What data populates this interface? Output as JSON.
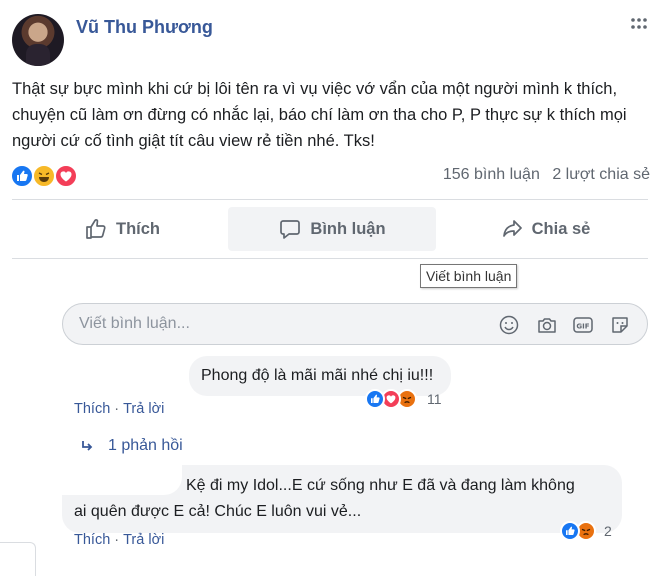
{
  "post": {
    "author": "Vũ Thu Phương",
    "text": "Thật sự bực mình khi cứ bị lôi tên ra vì vụ việc vớ vẩn của một người mình k thích, chuyện cũ làm ơn đừng có nhắc lại, báo chí làm ơn tha cho P, P thực sự k thích mọi người cứ cố tình giật tít câu view rẻ tiền nhé. Tks!",
    "reactions": [
      "like",
      "haha",
      "love"
    ],
    "comment_count": "156 bình luận",
    "share_count": "2 lượt chia sẻ"
  },
  "actions": {
    "like_label": "Thích",
    "comment_label": "Bình luận",
    "share_label": "Chia sẻ"
  },
  "tooltip": "Viết bình luận",
  "comment_input": {
    "placeholder": "Viết bình luận...",
    "icons": [
      "emoji-icon",
      "camera-icon",
      "gif-icon",
      "sticker-icon"
    ]
  },
  "comments": [
    {
      "text": "Phong độ là mãi mãi nhé chị iu!!!",
      "reactions": [
        "like",
        "love",
        "angry"
      ],
      "reaction_count": "11",
      "like_label": "Thích",
      "reply_label": "Trả lời",
      "replies_label": "1 phản hồi"
    },
    {
      "text_line1": "Kệ đi my Idol...E cứ sống như E đã và đang làm không",
      "text_line2": "ai quên được E cả! Chúc E luôn vui vẻ...",
      "reactions": [
        "like",
        "angry"
      ],
      "reaction_count": "2",
      "like_label": "Thích",
      "reply_label": "Trả lời"
    }
  ],
  "colors": {
    "link": "#385898",
    "like": "#1877f2",
    "haha": "#f7b928",
    "love": "#f33e58",
    "angry": "#e9710f",
    "bubble": "#f2f3f5"
  }
}
